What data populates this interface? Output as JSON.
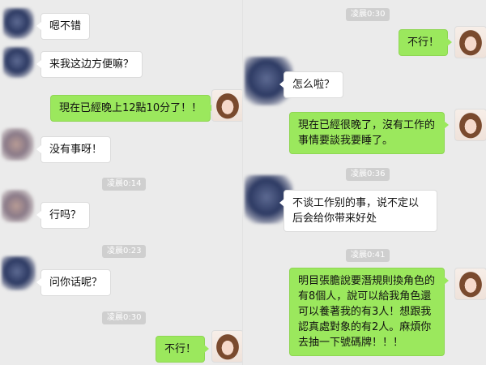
{
  "left_pane": {
    "messages": [
      {
        "text": "嗯不错"
      },
      {
        "text": "来我这边方便嘛？"
      },
      {
        "text": "現在已經晚上12點10分了！！"
      },
      {
        "text": "没有事呀！"
      },
      {
        "text": "行吗？"
      },
      {
        "text": "问你话呢？"
      },
      {
        "text": "不行！"
      }
    ],
    "timestamps": [
      "凌晨0:14",
      "凌晨0:23",
      "凌晨0:30"
    ]
  },
  "right_pane": {
    "messages": [
      {
        "text": "不行！"
      },
      {
        "text": "怎么啦？"
      },
      {
        "text": "現在已經很晚了，沒有工作的事情要談我要睡了。"
      },
      {
        "text": "不谈工作别的事，说不定以后会给你带来好处"
      },
      {
        "text": "明目張膽說要潛規則換角色的有8個人，說可以給我角色還可以養著我的有3人！想跟我認真處對象的有2人。麻煩你去抽一下號碼牌！！！"
      }
    ],
    "timestamps": [
      "凌晨0:30",
      "凌晨0:36",
      "凌晨0:41"
    ]
  },
  "colors": {
    "background": "#ebebeb",
    "incoming_bubble": "#ffffff",
    "outgoing_bubble": "#9be85d",
    "timestamp_chip": "#cfcfcf"
  }
}
